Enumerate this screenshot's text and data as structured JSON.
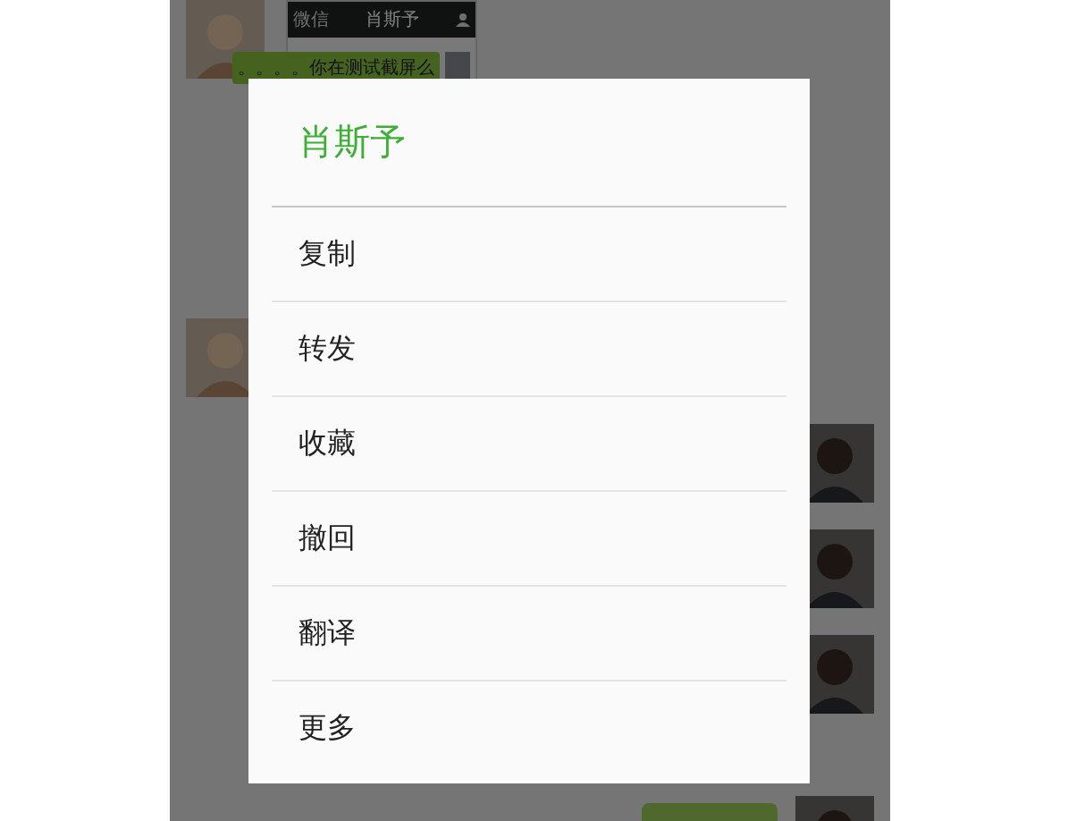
{
  "chat": {
    "shared_screenshot": {
      "back_label": "微信",
      "title": "肖斯予",
      "message": "。。。。你在测试截屏么"
    },
    "messages": [
      {
        "kind": "incoming"
      },
      {
        "kind": "outgoing"
      },
      {
        "kind": "outgoing"
      },
      {
        "kind": "outgoing"
      },
      {
        "kind": "outgoing"
      }
    ]
  },
  "dialog": {
    "title": "肖斯予",
    "items": [
      "复制",
      "转发",
      "收藏",
      "撤回",
      "翻译",
      "更多"
    ]
  }
}
